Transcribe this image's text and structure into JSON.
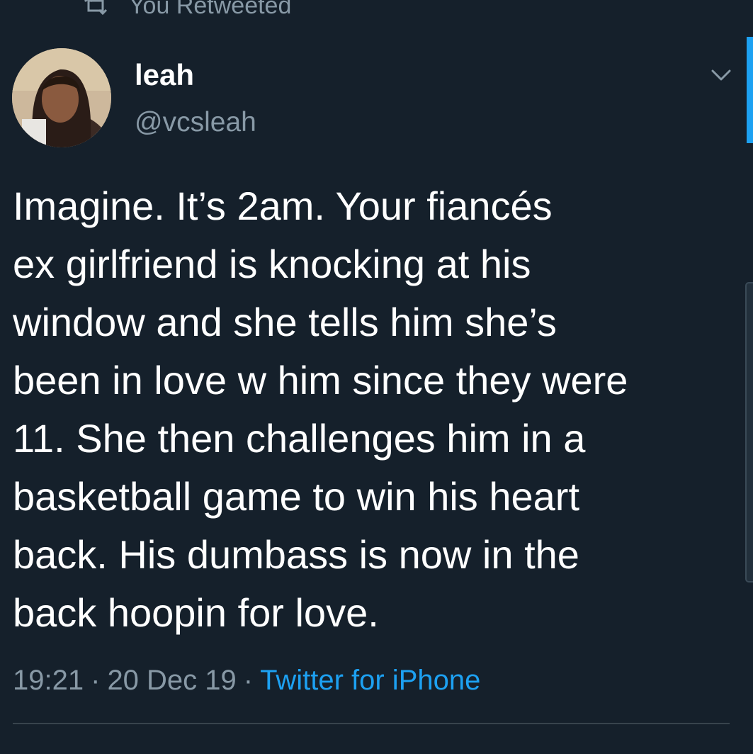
{
  "retweet_banner": {
    "icon": "retweet-icon",
    "label": "You Retweeted"
  },
  "author": {
    "display_name": "leah",
    "handle": "@vcsleah",
    "avatar": "avatar-photo"
  },
  "menu_icon": "chevron-down-icon",
  "tweet": {
    "text": "Imagine. It’s 2am. Your fiancés\nex girlfriend is knocking at his\nwindow and she tells him she’s\nbeen in love w him since they were\n11. She then challenges him in a\nbasketball game to win his heart\nback. His dumbass is now in the\nback hoopin for love."
  },
  "meta": {
    "time": "19:21",
    "separator": "·",
    "date": "20 Dec 19",
    "source": "Twitter for iPhone"
  },
  "colors": {
    "background": "#15202b",
    "secondary_text": "#8899a6",
    "accent": "#1da1f2",
    "divider": "#38444d"
  }
}
